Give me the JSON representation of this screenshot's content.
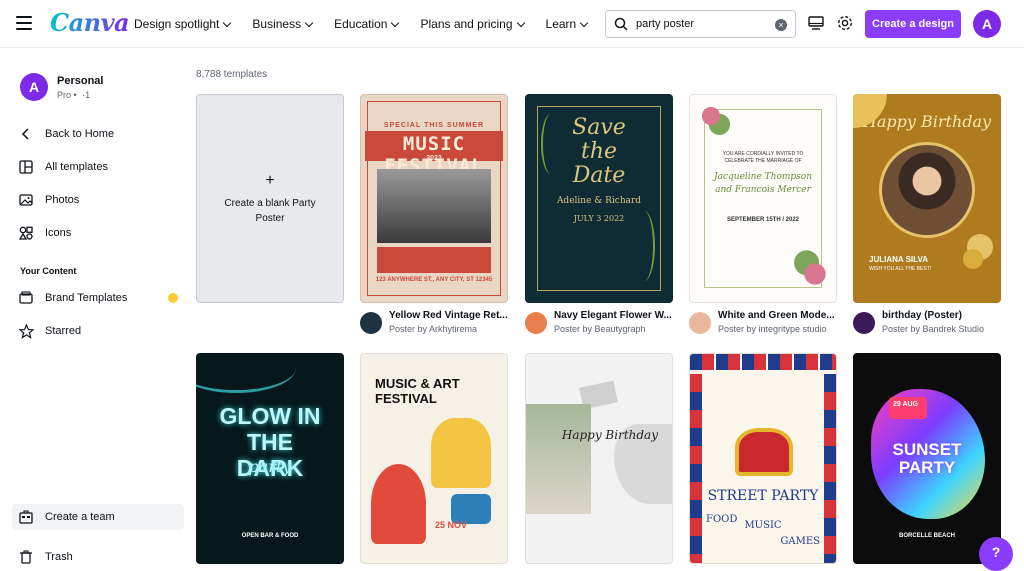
{
  "brand": "Canva",
  "nav": [
    "Design spotlight",
    "Business",
    "Education",
    "Plans and pricing",
    "Learn"
  ],
  "search": {
    "value": "party poster"
  },
  "create_label": "Create a design",
  "avatar_letter": "A",
  "sidebar": {
    "profile_name": "Personal",
    "profile_sub": "Pro •  ·1",
    "back": "Back to Home",
    "items": [
      "All templates",
      "Photos",
      "Icons"
    ],
    "heading": "Your Content",
    "content_items": [
      "Brand Templates",
      "Starred"
    ],
    "create_team": "Create a team",
    "trash": "Trash"
  },
  "template_count": "8,788 templates",
  "blank_card": {
    "plus": "+",
    "label": "Create a blank Party Poster"
  },
  "templates_row1": [
    {
      "name": "Yellow Red Vintage Ret...",
      "by": "Poster by Arkhytirema",
      "logo_color": "#1e3342"
    },
    {
      "name": "Navy Elegant Flower W...",
      "by": "Poster by Beautygraph",
      "logo_color": "#e87f4d"
    },
    {
      "name": "White and Green Mode...",
      "by": "Poster by integritype studio",
      "logo_color": "#e9b89c"
    },
    {
      "name": "birthday (Poster)",
      "by": "Poster by Bandrek Studio",
      "logo_color": "#3a1a57"
    }
  ],
  "poster_text": {
    "p1_top": "SPECIAL THIS SUMMER",
    "p1_title": "MUSIC FESTIVAL",
    "p1_year": "2023",
    "p1_bottom": "123 ANYWHERE ST., ANY CITY, ST 12345",
    "p2_title": "Save the Date",
    "p2_names": "Adeline & Richard",
    "p2_date": "JULY 3 2022",
    "p3_line": "YOU ARE CORDIALLY INVITED TO CELEBRATE THE MARRIAGE OF",
    "p3_names": "Jacqueline Thompson and Francois Mercer",
    "p3_date": "SEPTEMBER 15TH / 2022",
    "p4_title": "Happy Birthday",
    "p4_name": "JULIANA SILVA",
    "p4_wish": "WISH YOU ALL THE BEST!",
    "p5_title": "GLOW IN THE DARK",
    "p5_sub": "party",
    "p5_bottom": "OPEN BAR & FOOD",
    "p6_title": "MUSIC & ART FESTIVAL",
    "p6_date": "25 NOV",
    "p7_title": "Happy Birthday",
    "p8_title": "STREET PARTY",
    "p8_words": [
      "FOOD",
      "MUSIC",
      "GAMES"
    ],
    "p9_title": "SUNSET PARTY",
    "p9_date": "29 AUG",
    "p9_bottom": "BORCELLE BEACH"
  },
  "help": "?"
}
